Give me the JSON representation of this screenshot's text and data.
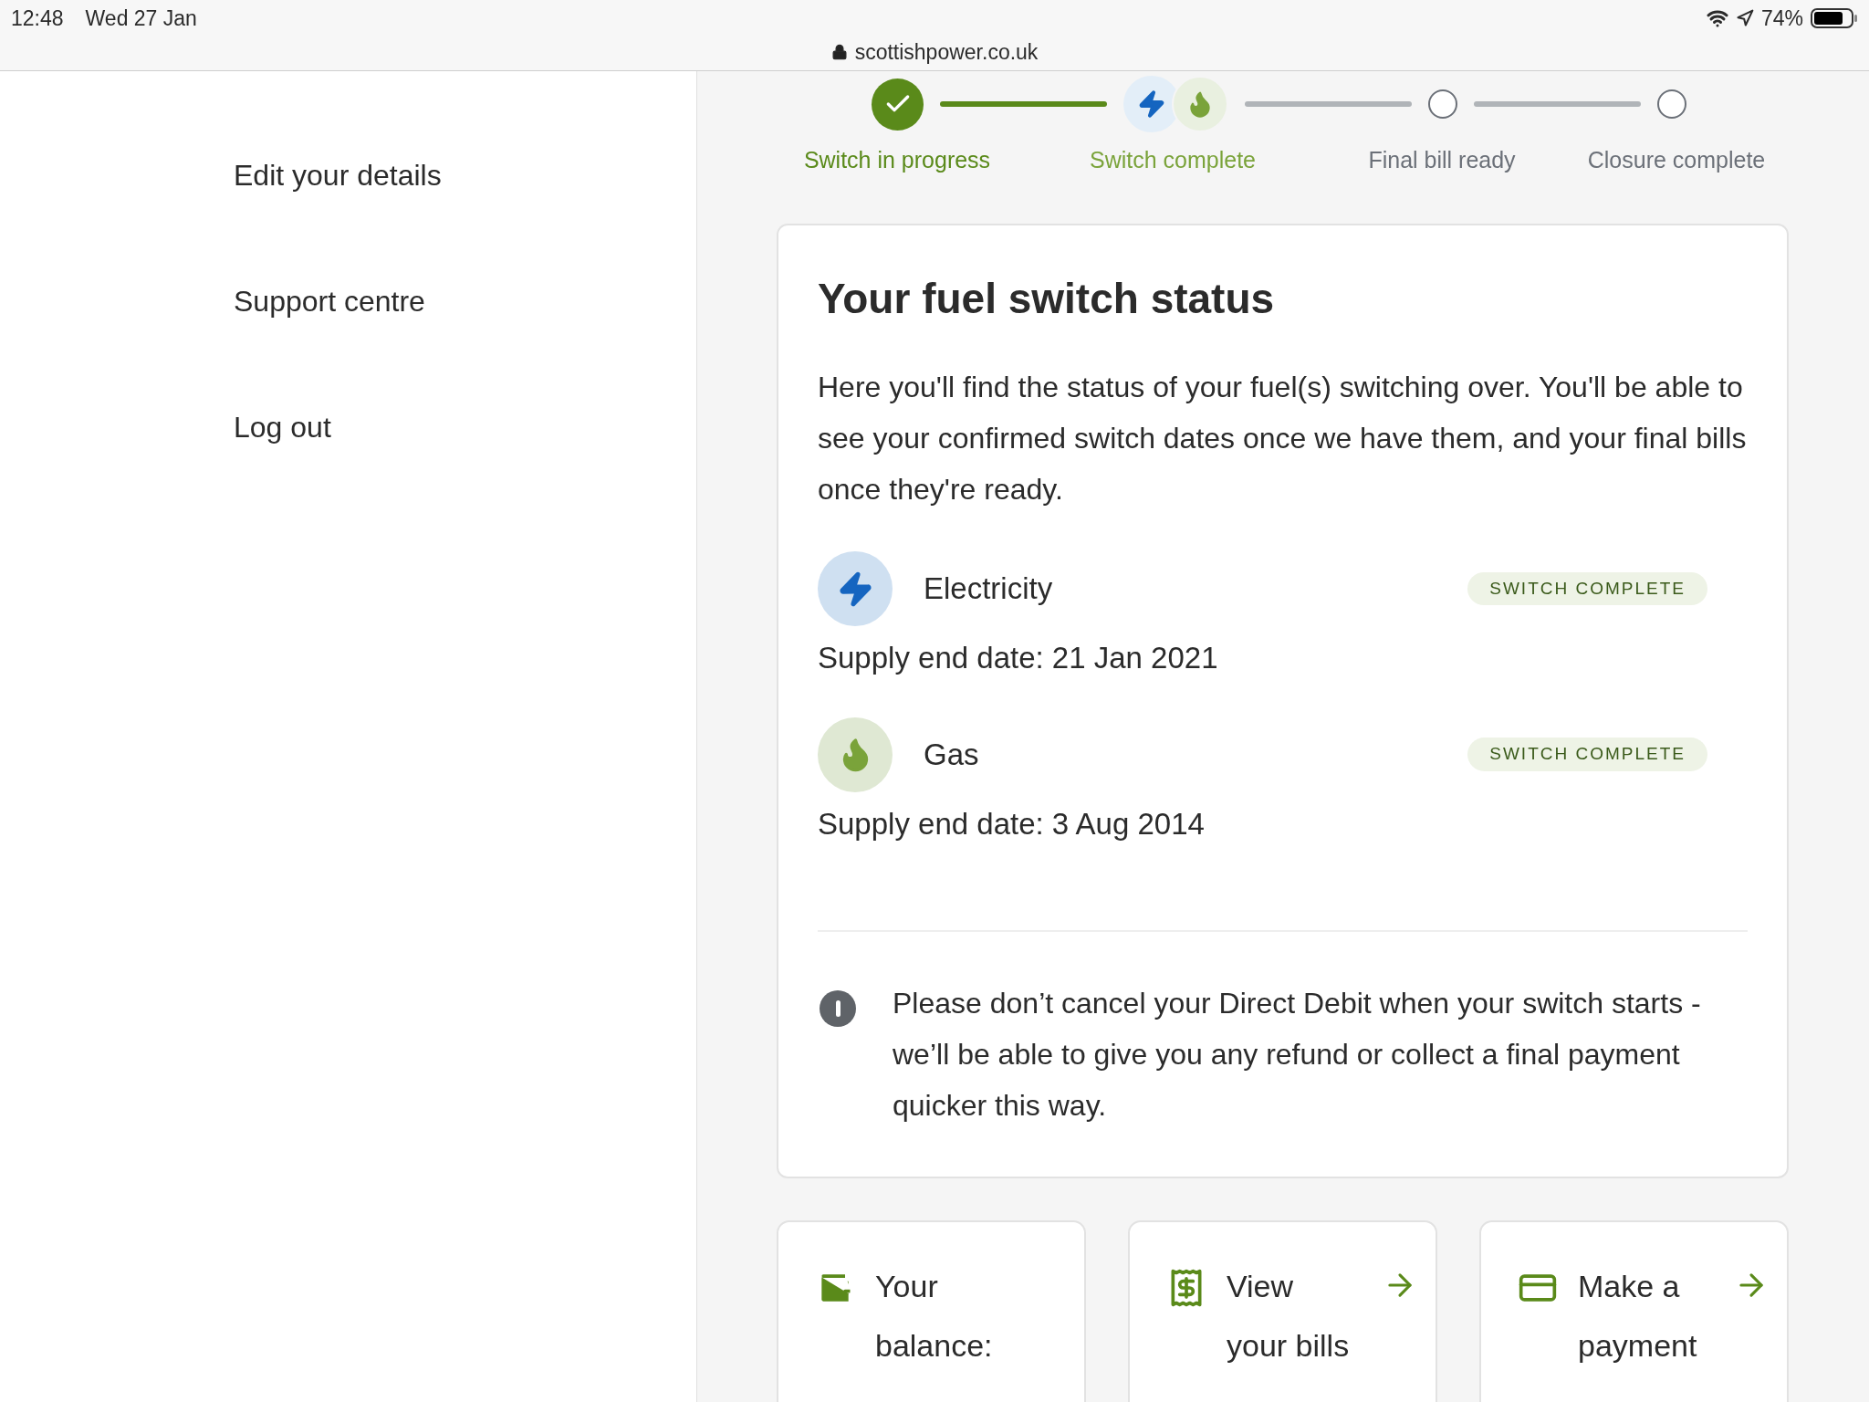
{
  "status_bar": {
    "time": "12:48",
    "date": "Wed 27 Jan",
    "battery": "74%"
  },
  "address_bar": {
    "url": "scottishpower.co.uk"
  },
  "sidebar": {
    "items": [
      {
        "label": "Edit your details"
      },
      {
        "label": "Support centre"
      },
      {
        "label": "Log out"
      }
    ]
  },
  "progress": {
    "steps": [
      {
        "label": "Switch in progress",
        "kind": "done"
      },
      {
        "label": "Switch complete",
        "kind": "current"
      },
      {
        "label": "Final bill ready",
        "kind": "pending"
      },
      {
        "label": "Closure complete",
        "kind": "pending"
      }
    ]
  },
  "status_card": {
    "title": "Your fuel switch status",
    "intro": "Here you'll find the status of your fuel(s) switching over. You'll be able to see your confirmed switch dates once we have them, and your final bills once they're ready.",
    "fuels": [
      {
        "name": "Electricity",
        "kind": "electricity",
        "badge": "SWITCH COMPLETE",
        "supply_end": "Supply end date: 21 Jan 2021"
      },
      {
        "name": "Gas",
        "kind": "gas",
        "badge": "SWITCH COMPLETE",
        "supply_end": "Supply end date: 3 Aug 2014"
      }
    ],
    "notice": "Please don’t cancel your Direct Debit when your switch starts - we’ll be able to give you any refund or collect a final payment quicker this way."
  },
  "tiles": [
    {
      "kind": "balance",
      "label": "Your balance:",
      "arrow": false
    },
    {
      "kind": "bills",
      "label": "View your bills",
      "arrow": true
    },
    {
      "kind": "payment",
      "label": "Make a payment",
      "arrow": true
    }
  ]
}
